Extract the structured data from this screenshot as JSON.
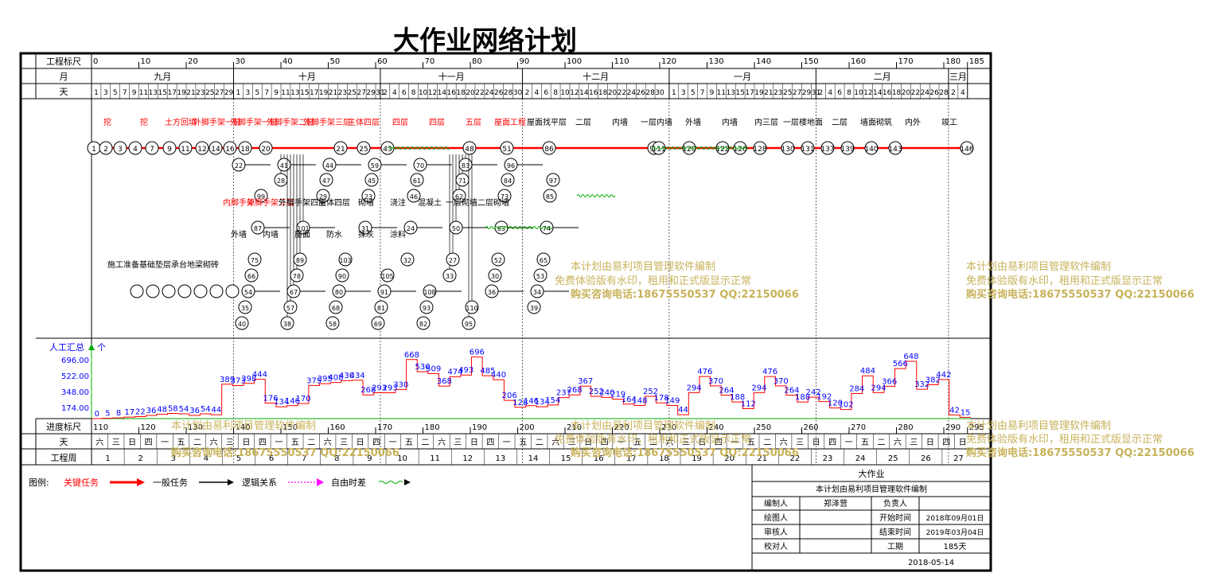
{
  "title": "大作业网络计划",
  "top_header": {
    "scale_label": "工程标尺",
    "month_label": "月",
    "day_label": "天",
    "scale_ticks": [
      "0",
      "10",
      "20",
      "30",
      "40",
      "50",
      "60",
      "70",
      "80",
      "90",
      "100",
      "110",
      "120",
      "130",
      "140",
      "150",
      "160",
      "170",
      "180",
      "185"
    ],
    "months": [
      "九月",
      "十月",
      "十一月",
      "十二月",
      "一月",
      "二月",
      "三月"
    ],
    "days": [
      [
        "1",
        "3",
        "5",
        "7",
        "9",
        "11",
        "13",
        "15",
        "17",
        "19",
        "21",
        "23",
        "25",
        "27",
        "29"
      ],
      [
        "1",
        "3",
        "5",
        "7",
        "9",
        "11",
        "13",
        "15",
        "17",
        "19",
        "21",
        "23",
        "25",
        "27",
        "29",
        "31"
      ],
      [
        "2",
        "4",
        "6",
        "8",
        "10",
        "12",
        "14",
        "16",
        "18",
        "20",
        "22",
        "24",
        "26",
        "28",
        "30"
      ],
      [
        "2",
        "4",
        "6",
        "8",
        "10",
        "12",
        "14",
        "16",
        "18",
        "20",
        "22",
        "24",
        "26",
        "28",
        "30"
      ],
      [
        "1",
        "3",
        "5",
        "7",
        "9",
        "11",
        "13",
        "15",
        "17",
        "19",
        "21",
        "23",
        "25",
        "27",
        "29",
        "31"
      ],
      [
        "2",
        "4",
        "6",
        "8",
        "10",
        "12",
        "14",
        "16",
        "18",
        "20",
        "22",
        "24",
        "26",
        "28"
      ],
      [
        "2",
        "4"
      ]
    ]
  },
  "network": {
    "critical_path": [
      "1",
      "2",
      "3",
      "4",
      "7",
      "9",
      "11",
      "12",
      "14",
      "16",
      "18",
      "20",
      "21",
      "25",
      "43",
      "48",
      "51",
      "86",
      "98",
      "111",
      "120",
      "122",
      "126",
      "128",
      "130",
      "131",
      "137",
      "139",
      "140",
      "143",
      "146"
    ],
    "top_labels": [
      "挖",
      "挖",
      "土方回填",
      "外脚手架一层",
      "外脚手架一层",
      "外脚手架二层",
      "外脚手架三层",
      "主体四层",
      "四层",
      "四层",
      "五层",
      "屋面工程",
      "屋面找平层",
      "二层",
      "内墙",
      "一层内墙",
      "外墙",
      "内墙",
      "内三层",
      "一层楼地面",
      "二层",
      "墙面砌筑",
      "内外",
      "竣工"
    ],
    "node_numbers": [
      "1",
      "2",
      "3",
      "4",
      "7",
      "9",
      "11",
      "12",
      "14",
      "16",
      "18",
      "20",
      "21",
      "25",
      "43",
      "48",
      "51",
      "86",
      "98",
      "111",
      "120",
      "122",
      "126",
      "128",
      "130",
      "131",
      "146",
      "22",
      "28",
      "29",
      "31",
      "32",
      "33",
      "36",
      "39",
      "40",
      "41",
      "47",
      "23",
      "24",
      "27",
      "30",
      "34",
      "35",
      "38",
      "44",
      "45",
      "46",
      "50",
      "52",
      "53",
      "54",
      "57",
      "58",
      "59",
      "61",
      "62",
      "63",
      "65",
      "66",
      "67",
      "68",
      "69",
      "70",
      "71",
      "73",
      "74",
      "75",
      "78",
      "80",
      "81",
      "82",
      "83",
      "84",
      "85",
      "87",
      "89",
      "90",
      "91",
      "93",
      "95",
      "96",
      "97",
      "99",
      "101",
      "103",
      "105",
      "108",
      "110"
    ],
    "left_labels": [
      "施工",
      "准备",
      "基础",
      "垫层",
      "承台",
      "地梁",
      "砌砖"
    ],
    "mid_labels": [
      "内脚手架",
      "外脚手架三层",
      "外脚手架四层",
      "主体四层",
      "砌墙",
      "浇注",
      "混凝土",
      "一层砌墙",
      "二层砌墙",
      "外墙",
      "内墙",
      "屋面",
      "防水",
      "抹灰",
      "涂料"
    ]
  },
  "resource": {
    "title": "人工汇总",
    "unit": "个",
    "y_ticks": [
      "696.00",
      "522.00",
      "348.00",
      "174.00"
    ],
    "y_values": [
      696,
      522,
      348,
      174
    ],
    "peak_labels": [
      "0",
      "5",
      "8",
      "17",
      "22",
      "36",
      "48",
      "58",
      "54",
      "36",
      "54",
      "44",
      "389",
      "373",
      "398",
      "444",
      "176",
      "134",
      "146",
      "170",
      "375",
      "395",
      "408",
      "430",
      "434",
      "268",
      "293",
      "293",
      "330",
      "668",
      "530",
      "509",
      "368",
      "474",
      "493",
      "696",
      "485",
      "440",
      "206",
      "128",
      "146",
      "134",
      "154",
      "237",
      "268",
      "367",
      "252",
      "240",
      "219",
      "164",
      "148",
      "252",
      "178",
      "149",
      "44",
      "294",
      "476",
      "370",
      "264",
      "188",
      "112",
      "294",
      "476",
      "370",
      "264",
      "188",
      "242",
      "192",
      "120",
      "102",
      "284",
      "484",
      "294",
      "366",
      "566",
      "648",
      "332",
      "382",
      "442",
      "42",
      "15"
    ]
  },
  "bottom_header": {
    "progress_label": "进度标尺",
    "day_label": "天",
    "week_label": "工程周",
    "progress_ticks": [
      "110",
      "120",
      "130",
      "140",
      "150",
      "160",
      "170",
      "180",
      "190",
      "200",
      "210",
      "220",
      "230",
      "240",
      "250",
      "260",
      "270",
      "280",
      "290",
      "295"
    ],
    "weekdays": [
      "六",
      "三",
      "日",
      "四",
      "一",
      "五",
      "二",
      "六",
      "三",
      "日",
      "四",
      "一",
      "五",
      "二",
      "六",
      "三",
      "日",
      "四",
      "一",
      "五",
      "二",
      "六",
      "三",
      "日",
      "四",
      "一",
      "五",
      "二",
      "六",
      "三",
      "日",
      "四",
      "一",
      "五",
      "二",
      "六",
      "三",
      "日",
      "四",
      "一",
      "五",
      "二",
      "六",
      "三",
      "日",
      "四",
      "一",
      "五",
      "二",
      "六",
      "三",
      "日",
      "四",
      "日"
    ],
    "weeks": [
      "1",
      "2",
      "3",
      "4",
      "5",
      "6",
      "7",
      "8",
      "9",
      "10",
      "11",
      "12",
      "13",
      "14",
      "15",
      "16",
      "17",
      "18",
      "19",
      "20",
      "21",
      "22",
      "23",
      "24",
      "25",
      "26",
      "27"
    ]
  },
  "legend": {
    "title": "图例:",
    "critical": "关键任务",
    "normal": "一般任务",
    "logic": "逻辑关系",
    "float": "自由时差",
    "critical_color": "#ff0000",
    "normal_color": "#000000",
    "logic_color": "#ff00ff",
    "float_color": "#00aa00"
  },
  "info": {
    "project": "大作业",
    "software": "本计划由易利项目管理软件编制",
    "editor_label": "编制人",
    "editor": "郑泽营",
    "responsible_label": "负责人",
    "drawer_label": "绘图人",
    "start_label": "开始时间",
    "start": "2018年09月01日",
    "reviewer_label": "审核人",
    "end_label": "结束时间",
    "end": "2019年03月04日",
    "checker_label": "校对人",
    "duration_label": "工期",
    "duration": "185天",
    "date": "2018-05-14"
  },
  "watermark": {
    "line1": "本计划由易利项目管理软件编制",
    "line2": "免费体验版有水印，租用和正式版显示正常",
    "line3": "购买咨询电话:18675550537 QQ:22150066"
  }
}
